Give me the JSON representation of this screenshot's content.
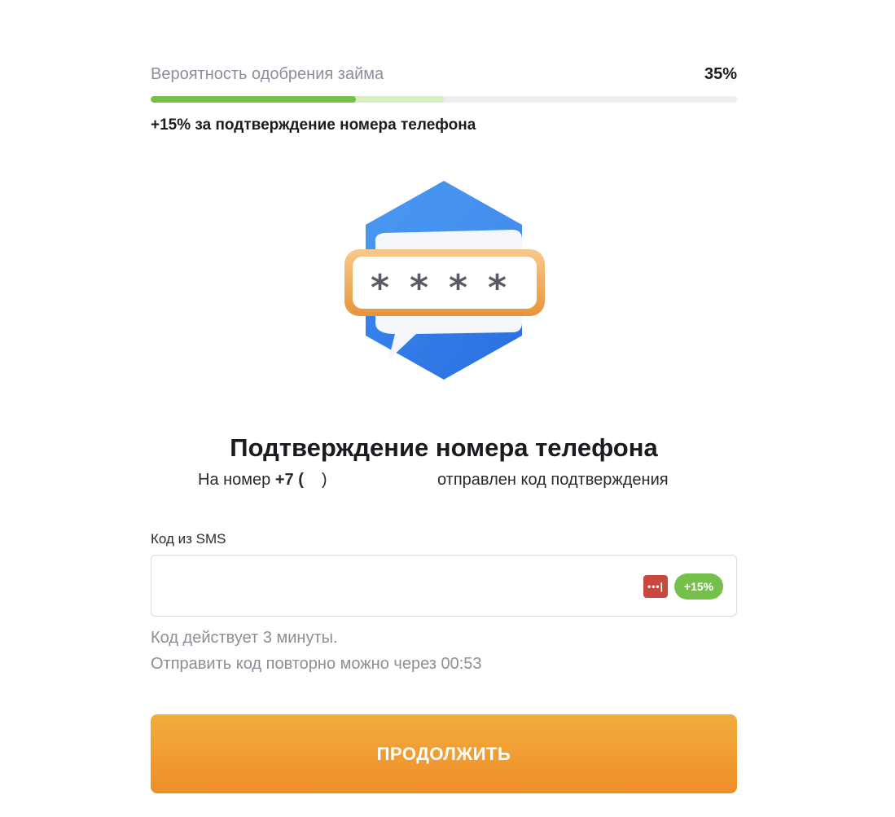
{
  "approval": {
    "label": "Вероятность одобрения займа",
    "value_text": "35%",
    "progress_fraction": 0.35,
    "bonus_fraction": 0.15,
    "bonus_text": "+15% за подтверждение номера телефона"
  },
  "illustration": {
    "icon": "sms-code-icon",
    "mask": "****"
  },
  "header": {
    "title": "Подтверждение номера телефона",
    "subtitle_prefix": "На номер ",
    "phone_prefix": "+7 (",
    "phone_suffix": ")",
    "subtitle_suffix": "отправлен код подтверждения"
  },
  "form": {
    "code_label": "Код из SMS",
    "code_value": "",
    "password_manager_icon": "password-manager-icon",
    "badge": "+15%"
  },
  "hints": {
    "validity": "Код действует 3 минуты.",
    "resend": "Отправить код повторно можно через 00:53"
  },
  "actions": {
    "continue_label": "ПРОДОЛЖИТЬ"
  },
  "colors": {
    "progress": "#74c04a",
    "progress_bonus": "#d8ecc5",
    "button": "#f0992f",
    "badge": "#74c04a"
  }
}
